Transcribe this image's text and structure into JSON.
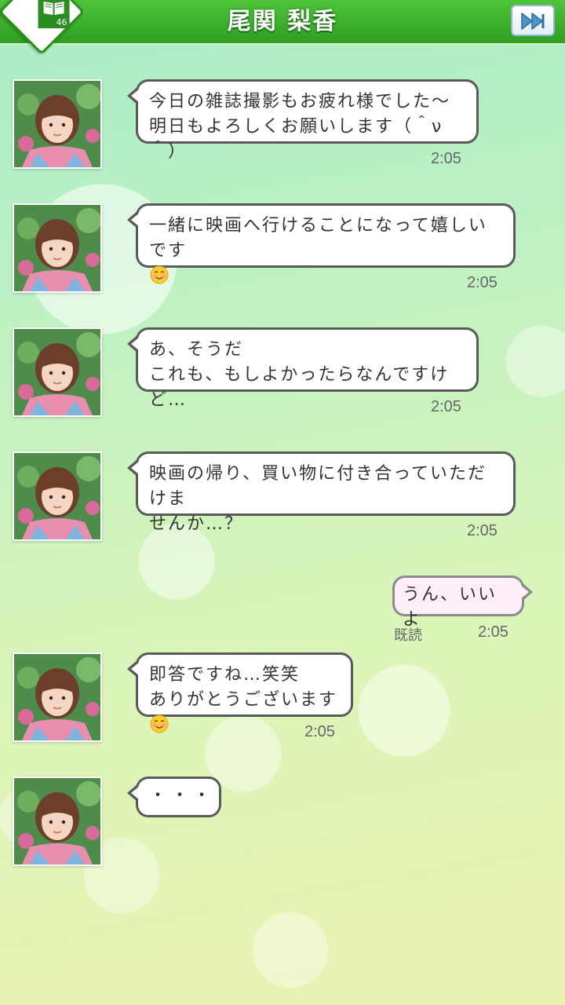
{
  "header": {
    "title": "尾関 梨香",
    "logo_number": "46",
    "logo_icon": "book-icon",
    "skip_icon": "fast-forward-icon",
    "color": "#3fb52e"
  },
  "contact": {
    "avatar_icon": "avatar-photo"
  },
  "messages": [
    {
      "from": "contact",
      "line1": "今日の雑誌撮影もお疲れ様でした〜",
      "line2": "明日もよろしくお願いします（＾ν＾）",
      "time": "2:05"
    },
    {
      "from": "contact",
      "line1": "一緒に映画へ行けることになって嬉しいです",
      "emoji": "smiling-face-icon",
      "time": "2:05"
    },
    {
      "from": "contact",
      "line1": "あ、そうだ",
      "line2": "これも、もしよかったらなんですけど…",
      "time": "2:05"
    },
    {
      "from": "contact",
      "line1": "映画の帰り、買い物に付き合っていただけま",
      "line2": "せんか…？",
      "time": "2:05"
    },
    {
      "from": "user",
      "line1": "うん、いいよ",
      "read": "既読",
      "time": "2:05"
    },
    {
      "from": "contact",
      "line1": "即答ですね…笑笑",
      "line2": "ありがとうございます",
      "emoji": "smiling-face-icon",
      "time": "2:05"
    },
    {
      "from": "contact",
      "line1": "・・・"
    }
  ]
}
